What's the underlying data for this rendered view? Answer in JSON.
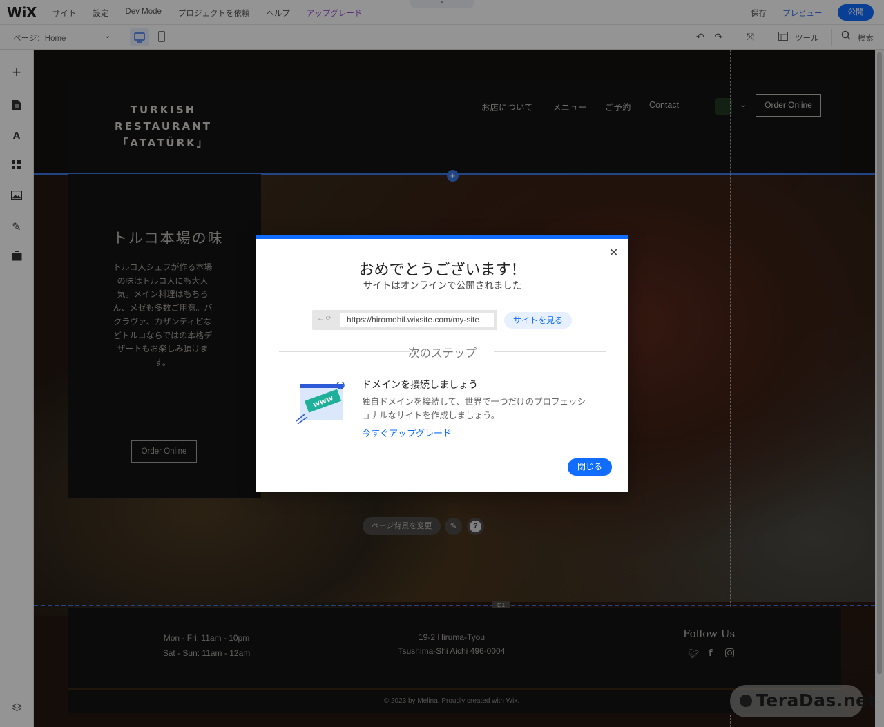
{
  "editor": {
    "logo": "WiX",
    "menu": [
      "サイト",
      "設定",
      "Dev Mode",
      "プロジェクトを依頼",
      "ヘルプ"
    ],
    "upgrade": "アップグレード",
    "save": "保存",
    "preview": "プレビュー",
    "publish": "公開",
    "page_selector": "ページ：Home",
    "tools": "ツール",
    "search": "検索",
    "colors": {
      "accent": "#116dff",
      "upgrade": "#9a4fd7"
    }
  },
  "site": {
    "brand": [
      "TURKISH",
      "RESTAURANT",
      "「ATATÜRK」"
    ],
    "nav": [
      "お店について",
      "メニュー",
      "ご予約",
      "Contact"
    ],
    "order_online": "Order Online",
    "section_title": "トルコ本場の味",
    "section_text": "トルコ人シェフが作る本場の味はトルコ人にも大人気。メイン料理はもちろん、メゼも多数ご用意。バクラヴァ、カザンディビなどトルコならではの本格デザートもお楽しみ頂けます。",
    "section_order": "Order Online",
    "page_bg_button": "ページ背景を変更",
    "footer": {
      "hours": [
        "Mon - Fri: 11am - 10pm",
        "Sat - Sun: 11am - 12am"
      ],
      "address": [
        "19-2 Hiruma-Tyou",
        "Tsushima-Shi Aichi 496-0004"
      ],
      "follow": "Follow Us",
      "copyright": "© 2023 by Melina. Proudly created with Wix."
    },
    "watermark": "TeraDas.net"
  },
  "modal": {
    "title": "おめでとうございます！",
    "subtitle": "サイトはオンラインで公開されました",
    "url": "https://hiromohil.wixsite.com/my-site",
    "view_site": "サイトを見る",
    "next_steps": "次のステップ",
    "domain_title": "ドメインを接続しましょう",
    "domain_desc": "独自ドメインを接続して、世界で一つだけのプロフェッショナルなサイトを作成しましょう。",
    "upgrade_link": "今すぐアップグレード",
    "close_button": "閉じる",
    "illustration_label": "www"
  }
}
